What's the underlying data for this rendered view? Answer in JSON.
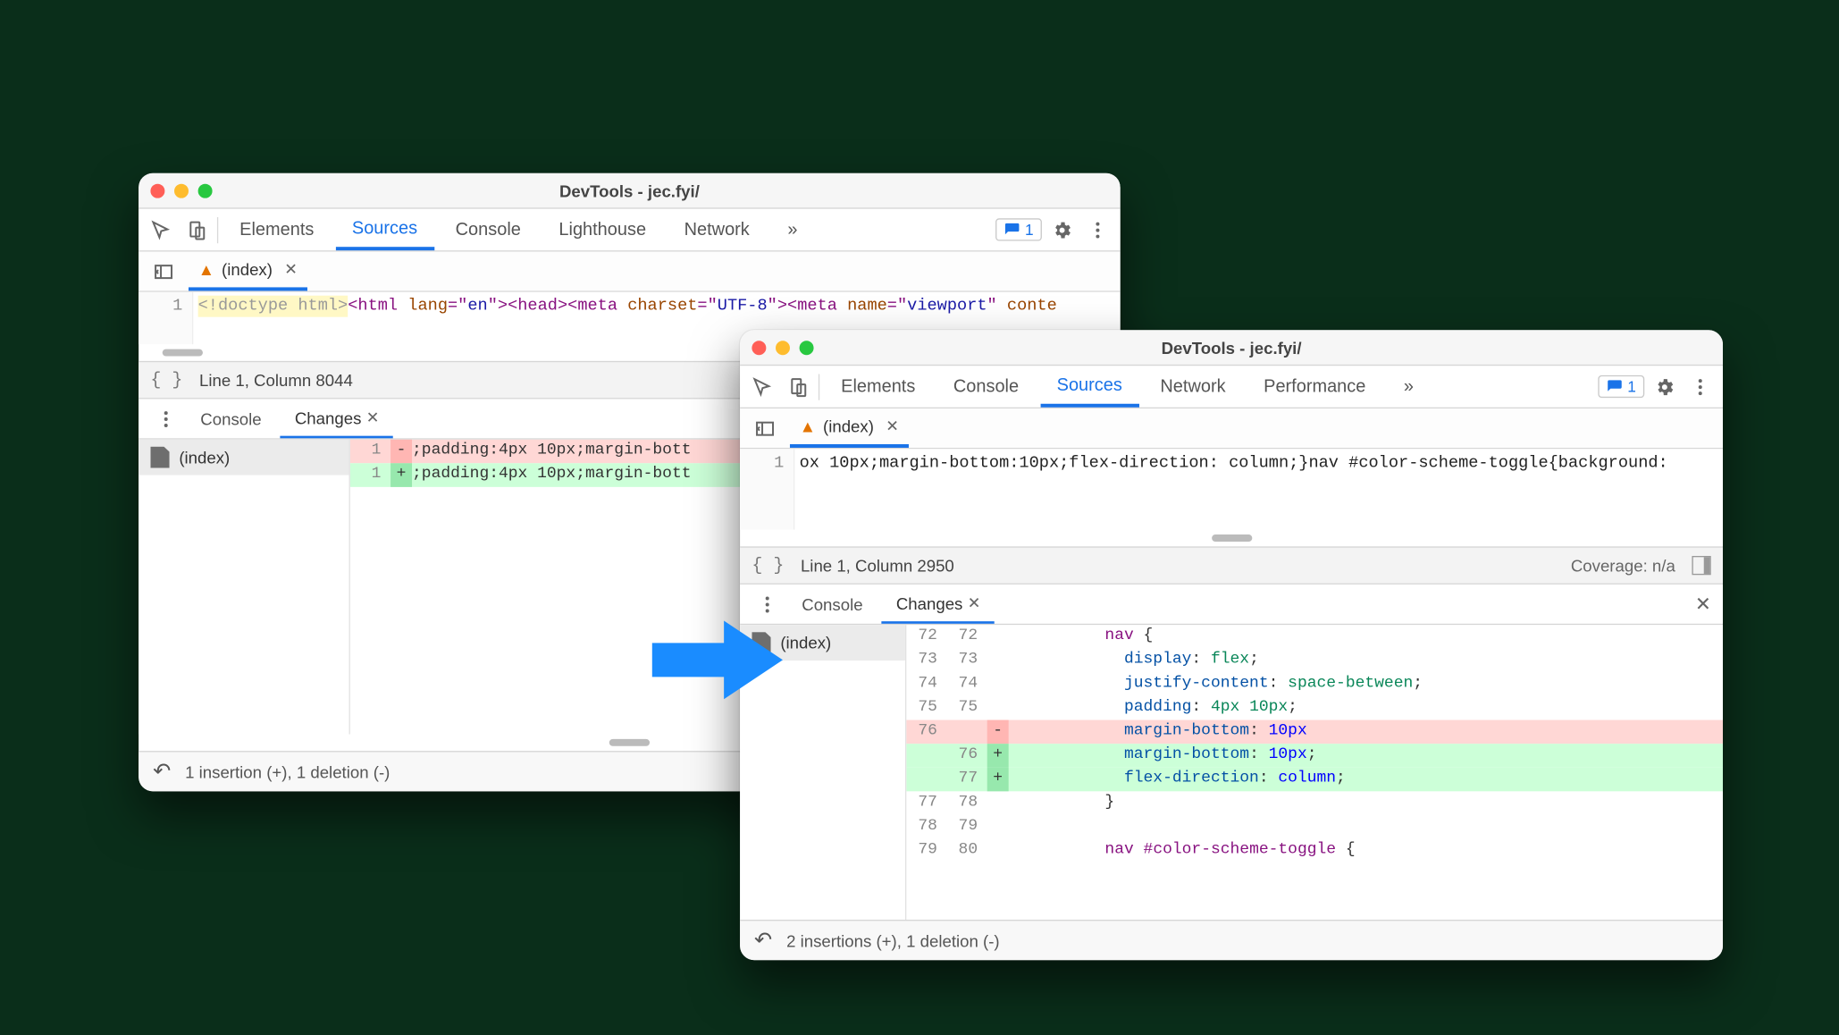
{
  "windowA": {
    "title": "DevTools - jec.fyi/",
    "tabs": [
      "Elements",
      "Sources",
      "Console",
      "Lighthouse",
      "Network"
    ],
    "active_tab": "Sources",
    "overflow": "»",
    "issue_count": "1",
    "filetab": "(index)",
    "code": {
      "line_no": "1",
      "tokens": [
        {
          "t": "<!doctype html>",
          "c": "tok-doctype",
          "hl": true
        },
        {
          "t": "<html ",
          "c": "tok-tag"
        },
        {
          "t": "lang",
          "c": "tok-attr"
        },
        {
          "t": "=\"",
          "c": "tok-tag"
        },
        {
          "t": "en",
          "c": "tok-str"
        },
        {
          "t": "\">",
          "c": "tok-tag"
        },
        {
          "t": "<head>",
          "c": "tok-tag"
        },
        {
          "t": "<meta ",
          "c": "tok-tag"
        },
        {
          "t": "charset",
          "c": "tok-attr"
        },
        {
          "t": "=\"",
          "c": "tok-tag"
        },
        {
          "t": "UTF-8",
          "c": "tok-str"
        },
        {
          "t": "\">",
          "c": "tok-tag"
        },
        {
          "t": "<meta ",
          "c": "tok-tag"
        },
        {
          "t": "name",
          "c": "tok-attr"
        },
        {
          "t": "=\"",
          "c": "tok-tag"
        },
        {
          "t": "viewport",
          "c": "tok-str"
        },
        {
          "t": "\" ",
          "c": "tok-tag"
        },
        {
          "t": "conte",
          "c": "tok-attr"
        }
      ]
    },
    "status": "Line 1, Column 8044",
    "drawer": {
      "tabs": [
        "Console",
        "Changes"
      ],
      "active": "Changes",
      "file": "(index)",
      "rows": [
        {
          "l1": "1",
          "l2": "",
          "sign": "-",
          "cls": "del",
          "txt": ";padding:4px 10px;margin-bott"
        },
        {
          "l1": "1",
          "l2": "",
          "sign": "+",
          "cls": "add",
          "txt": ";padding:4px 10px;margin-bott"
        }
      ]
    },
    "footer": "1 insertion (+), 1 deletion (-)"
  },
  "windowB": {
    "title": "DevTools - jec.fyi/",
    "tabs": [
      "Elements",
      "Console",
      "Sources",
      "Network",
      "Performance"
    ],
    "active_tab": "Sources",
    "overflow": "»",
    "issue_count": "1",
    "filetab": "(index)",
    "code": {
      "line_no": "1",
      "raw": "ox 10px;margin-bottom:10px;flex-direction: column;}nav #color-scheme-toggle{background:"
    },
    "status": "Line 1, Column 2950",
    "coverage": "Coverage: n/a",
    "drawer": {
      "tabs": [
        "Console",
        "Changes"
      ],
      "active": "Changes",
      "file": "(index)",
      "rows": [
        {
          "l1": "72",
          "l2": "72",
          "sign": "",
          "cls": "",
          "segs": [
            {
              "t": "          ",
              "c": ""
            },
            {
              "t": "nav",
              "c": "tok-sel"
            },
            {
              "t": " {",
              "c": ""
            }
          ]
        },
        {
          "l1": "73",
          "l2": "73",
          "sign": "",
          "cls": "",
          "segs": [
            {
              "t": "            ",
              "c": ""
            },
            {
              "t": "display",
              "c": "tok-prop"
            },
            {
              "t": ": ",
              "c": ""
            },
            {
              "t": "flex",
              "c": "tok-val"
            },
            {
              "t": ";",
              "c": ""
            }
          ]
        },
        {
          "l1": "74",
          "l2": "74",
          "sign": "",
          "cls": "",
          "segs": [
            {
              "t": "            ",
              "c": ""
            },
            {
              "t": "justify-content",
              "c": "tok-prop"
            },
            {
              "t": ": ",
              "c": ""
            },
            {
              "t": "space-between",
              "c": "tok-val"
            },
            {
              "t": ";",
              "c": ""
            }
          ]
        },
        {
          "l1": "75",
          "l2": "75",
          "sign": "",
          "cls": "",
          "segs": [
            {
              "t": "            ",
              "c": ""
            },
            {
              "t": "padding",
              "c": "tok-prop"
            },
            {
              "t": ": ",
              "c": ""
            },
            {
              "t": "4px 10px",
              "c": "tok-val"
            },
            {
              "t": ";",
              "c": ""
            }
          ]
        },
        {
          "l1": "76",
          "l2": "",
          "sign": "-",
          "cls": "del",
          "segs": [
            {
              "t": "            ",
              "c": ""
            },
            {
              "t": "margin-bottom",
              "c": "tok-prop"
            },
            {
              "t": ": ",
              "c": ""
            },
            {
              "t": "10px",
              "c": "tok-num"
            }
          ]
        },
        {
          "l1": "",
          "l2": "76",
          "sign": "+",
          "cls": "add",
          "segs": [
            {
              "t": "            ",
              "c": ""
            },
            {
              "t": "margin-bottom",
              "c": "tok-prop"
            },
            {
              "t": ": ",
              "c": ""
            },
            {
              "t": "10px",
              "c": "tok-num"
            },
            {
              "t": ";",
              "c": ""
            }
          ]
        },
        {
          "l1": "",
          "l2": "77",
          "sign": "+",
          "cls": "add",
          "segs": [
            {
              "t": "            ",
              "c": ""
            },
            {
              "t": "flex-direction",
              "c": "tok-prop"
            },
            {
              "t": ": ",
              "c": ""
            },
            {
              "t": "column",
              "c": "tok-num"
            },
            {
              "t": ";",
              "c": ""
            }
          ]
        },
        {
          "l1": "77",
          "l2": "78",
          "sign": "",
          "cls": "",
          "segs": [
            {
              "t": "          }",
              "c": ""
            }
          ]
        },
        {
          "l1": "78",
          "l2": "79",
          "sign": "",
          "cls": "",
          "segs": [
            {
              "t": " ",
              "c": ""
            }
          ]
        },
        {
          "l1": "79",
          "l2": "80",
          "sign": "",
          "cls": "",
          "segs": [
            {
              "t": "          ",
              "c": ""
            },
            {
              "t": "nav",
              "c": "tok-sel"
            },
            {
              "t": " ",
              "c": ""
            },
            {
              "t": "#color-scheme-toggle",
              "c": "tok-sel"
            },
            {
              "t": " {",
              "c": ""
            }
          ]
        }
      ]
    },
    "footer": "2 insertions (+), 1 deletion (-)"
  }
}
